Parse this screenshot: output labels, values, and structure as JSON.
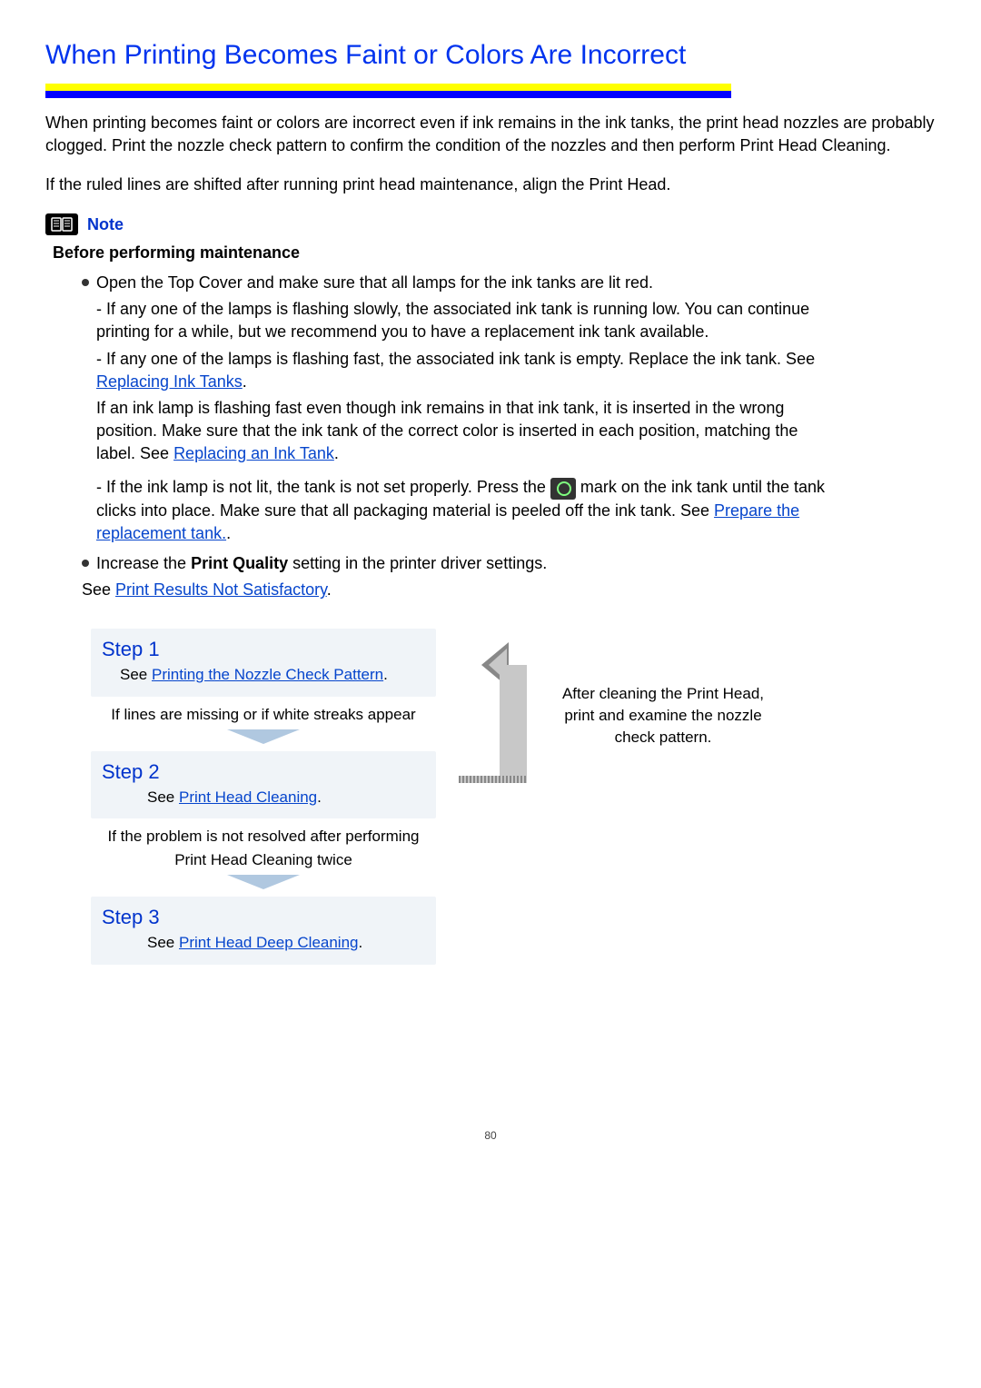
{
  "title": "When Printing Becomes Faint or Colors Are Incorrect",
  "intro1": "When printing becomes faint or colors are incorrect even if ink remains in the ink tanks, the print head nozzles are probably clogged. Print the nozzle check pattern to confirm the condition of the nozzles and then perform Print Head Cleaning.",
  "intro2": "If the ruled lines are shifted after running print head maintenance, align the Print Head.",
  "note_label": "Note",
  "before_maintenance": "Before performing maintenance",
  "bullet1_main": "Open the Top Cover and make sure that all lamps for the ink tanks are lit red.",
  "bullet1_sub1": "- If any one of the lamps is flashing slowly, the associated ink tank is running low. You can continue printing for a while, but we recommend you to have a replacement ink tank available.",
  "bullet1_sub2_pre": "- If any one of the lamps is flashing fast, the associated ink tank is empty. Replace the ink tank. See ",
  "bullet1_sub2_link": "Replacing Ink Tanks",
  "bullet1_sub2_post": ".",
  "bullet1_sub3_pre": "If an ink lamp is flashing fast even though ink remains in that ink tank, it is inserted in the wrong position. Make sure that the ink tank of the correct color is inserted in each position, matching the label. See ",
  "bullet1_sub3_link": "Replacing an Ink Tank",
  "bullet1_sub3_post": ".",
  "bullet1_sub4_pre": "- If the ink lamp is not lit, the tank is not set properly. Press the ",
  "bullet1_sub4_mid": " mark on the ink tank until the tank clicks into place. Make sure that all packaging material is peeled off the ink tank. See ",
  "bullet1_sub4_link": "Prepare the replacement tank.",
  "bullet1_sub4_post": ".",
  "bullet2_pre": "Increase the ",
  "bullet2_bold": "Print Quality",
  "bullet2_post": " setting in the printer driver settings.",
  "bullet2_sub_pre": "See ",
  "bullet2_sub_link": "Print Results Not Satisfactory",
  "bullet2_sub_post": ".",
  "step1_title": "Step 1",
  "step1_pre": "See ",
  "step1_link": "Printing the Nozzle Check Pattern",
  "step1_post": ".",
  "flow1_text": "If lines are missing or if white streaks appear",
  "step2_title": "Step 2",
  "step2_pre": "See ",
  "step2_link": "Print Head Cleaning",
  "step2_post": ".",
  "flow2_text1": "If the problem is not resolved after performing",
  "flow2_text2": "Print Head Cleaning twice",
  "step3_title": "Step 3",
  "step3_pre": "See ",
  "step3_link": "Print Head Deep Cleaning",
  "step3_post": ".",
  "right_text": "After cleaning the Print Head, print and examine the nozzle check pattern.",
  "page_number": "80"
}
